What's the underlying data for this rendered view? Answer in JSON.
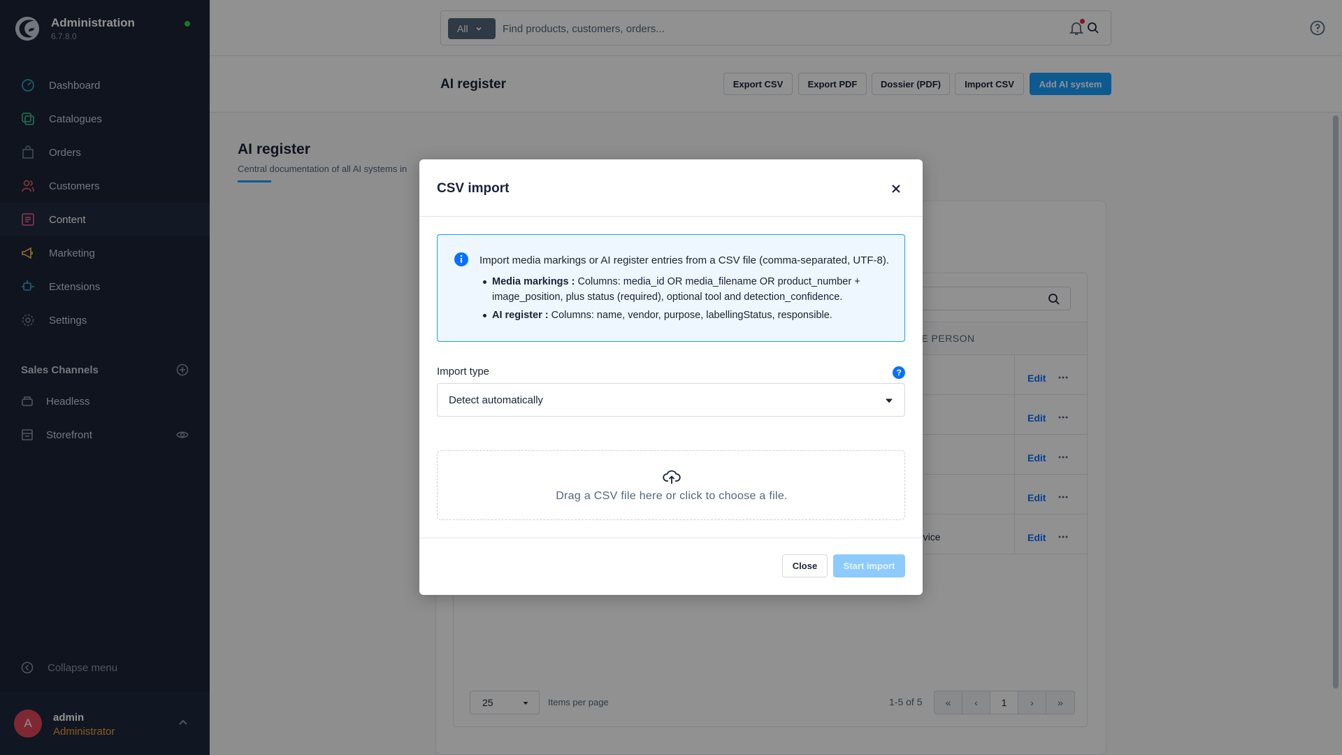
{
  "app": {
    "title": "Administration",
    "version": "6.7.8.0"
  },
  "sidebar": {
    "items": [
      {
        "label": "Dashboard",
        "icon": "dashboard-icon"
      },
      {
        "label": "Catalogues",
        "icon": "catalogues-icon"
      },
      {
        "label": "Orders",
        "icon": "orders-icon"
      },
      {
        "label": "Customers",
        "icon": "customers-icon"
      },
      {
        "label": "Content",
        "icon": "content-icon",
        "active": true
      },
      {
        "label": "Marketing",
        "icon": "marketing-icon"
      },
      {
        "label": "Extensions",
        "icon": "extensions-icon"
      },
      {
        "label": "Settings",
        "icon": "settings-icon"
      }
    ],
    "sales_channels_title": "Sales Channels",
    "sales_channels": [
      {
        "label": "Headless",
        "icon": "headless-icon"
      },
      {
        "label": "Storefront",
        "icon": "storefront-icon"
      }
    ],
    "collapse_label": "Collapse menu",
    "user": {
      "initial": "A",
      "name": "admin",
      "role": "Administrator"
    }
  },
  "topbar": {
    "search_scope": "All",
    "search_placeholder": "Find products, customers, orders..."
  },
  "smartbar": {
    "title": "AI register",
    "buttons": {
      "export_csv": "Export CSV",
      "export_pdf": "Export PDF",
      "dossier": "Dossier (PDF)",
      "import_csv": "Import CSV",
      "add": "Add AI system"
    }
  },
  "page": {
    "title": "AI register",
    "subtitle": "Central documentation of all AI systems in"
  },
  "grid": {
    "column_partial": "LE PERSON",
    "rows": [
      {
        "text": "",
        "edit": "Edit"
      },
      {
        "text": "",
        "edit": "Edit"
      },
      {
        "text": "",
        "edit": "Edit"
      },
      {
        "text": "",
        "edit": "Edit"
      },
      {
        "text": "rvice",
        "edit": "Edit"
      }
    ],
    "per_page_value": "25",
    "per_page_label": "Items per page",
    "count": "1-5 of 5",
    "pages": {
      "first": "«",
      "prev": "‹",
      "current": "1",
      "next": "›",
      "last": "»"
    }
  },
  "modal": {
    "title": "CSV import",
    "info_text": "Import media markings or AI register entries from a CSV file (comma-separated, UTF-8).",
    "info_items": [
      {
        "term": "Media markings :",
        "text": "Columns: media_id OR media_filename OR product_number + image_position, plus status (required), optional tool and detection_confidence."
      },
      {
        "term": "AI register :",
        "text": "Columns: name, vendor, purpose, labellingStatus, responsible."
      }
    ],
    "import_type_label": "Import type",
    "import_type_help": "?",
    "import_type_value": "Detect automatically",
    "dropzone_text": "Drag a CSV file here or click to choose a file.",
    "close_label": "Close",
    "start_label": "Start import"
  },
  "colors": {
    "sidebar_bg": "#1b2436",
    "accent": "#189eff",
    "link": "#0870ff",
    "role": "#f19d38",
    "status_dot": "#37d046",
    "notification_dot": "#de294c"
  }
}
